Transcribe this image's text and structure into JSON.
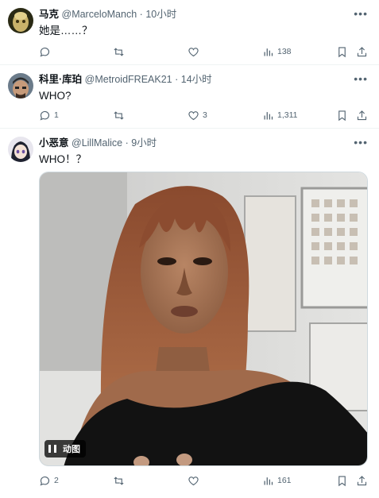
{
  "tweets": [
    {
      "name": "马克",
      "handle": "@MarceloManch",
      "sep": "·",
      "time": "10小时",
      "text": "她是……？",
      "replies": "",
      "retweets": "",
      "likes": "",
      "views": "138"
    },
    {
      "name": "科里·库珀",
      "handle": "@MetroidFREAK21",
      "sep": "·",
      "time": "14小时",
      "text": "WHO?",
      "replies": "1",
      "retweets": "",
      "likes": "3",
      "views": "1,311"
    },
    {
      "name": "小恶意",
      "handle": "@LillMalice",
      "sep": "·",
      "time": "9小时",
      "text": "WHO！？",
      "replies": "2",
      "retweets": "",
      "likes": "",
      "views": "161",
      "media": {
        "badge": "动图"
      }
    }
  ],
  "icons": {
    "more": "more-horizontal-icon",
    "reply": "reply-bubble-icon",
    "retweet": "retweet-icon",
    "like": "heart-icon",
    "views": "bar-chart-icon",
    "bookmark": "bookmark-icon",
    "share": "share-upload-icon",
    "pause": "pause-icon"
  },
  "colors": {
    "text": "#0f1419",
    "secondary": "#536471",
    "divider": "#eff3f4"
  }
}
